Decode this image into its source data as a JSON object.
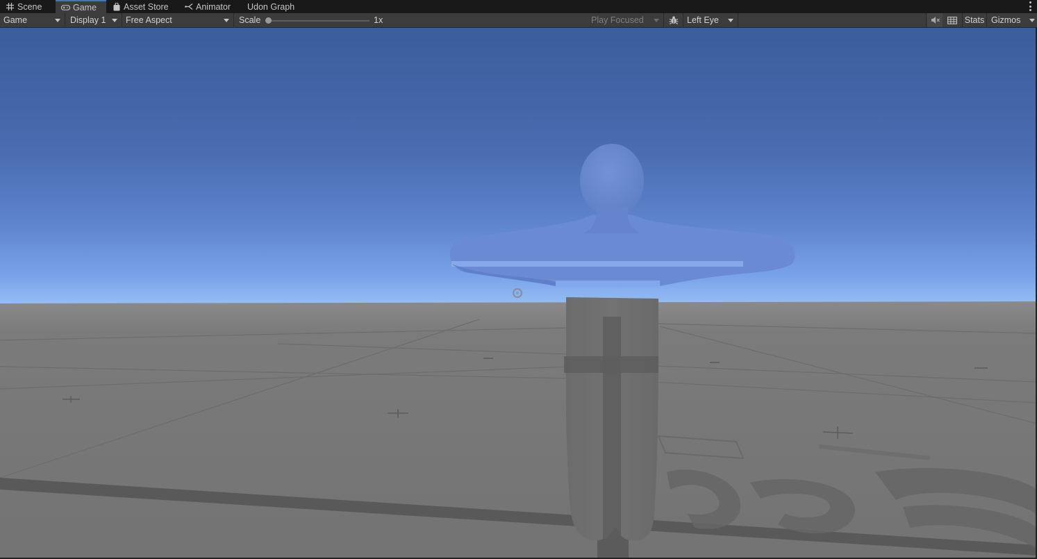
{
  "tabs": [
    {
      "label": "Scene",
      "icon": "grid-icon"
    },
    {
      "label": "Game",
      "icon": "gamepad-icon",
      "active": true
    },
    {
      "label": "Asset Store",
      "icon": "shopping-bag-icon"
    },
    {
      "label": "Animator",
      "icon": "animator-icon"
    },
    {
      "label": "Udon Graph",
      "icon": ""
    }
  ],
  "toolbar": {
    "mode_dropdown": "Game",
    "display_dropdown": "Display 1",
    "aspect_dropdown": "Free Aspect",
    "scale_label": "Scale",
    "scale_value": "1x",
    "scale_level": 0,
    "play_focused_dropdown": "Play Focused",
    "eye_dropdown": "Left Eye",
    "stats_label": "Stats",
    "gizmos_label": "Gizmos",
    "icons": [
      "bug-icon",
      "mute-audio-icon",
      "grid-toggle-icon",
      "kebab-menu-icon"
    ]
  },
  "colors": {
    "accent": "#3a79bb",
    "toolbar_bg": "#3c3c3c",
    "tabstrip_bg": "#191919",
    "sky_top": "#3b5d9b",
    "sky_horizon": "#8cb6f2",
    "ground": "#727272",
    "avatar_upper": "#6d8dd6",
    "avatar_legs": "#707070"
  }
}
